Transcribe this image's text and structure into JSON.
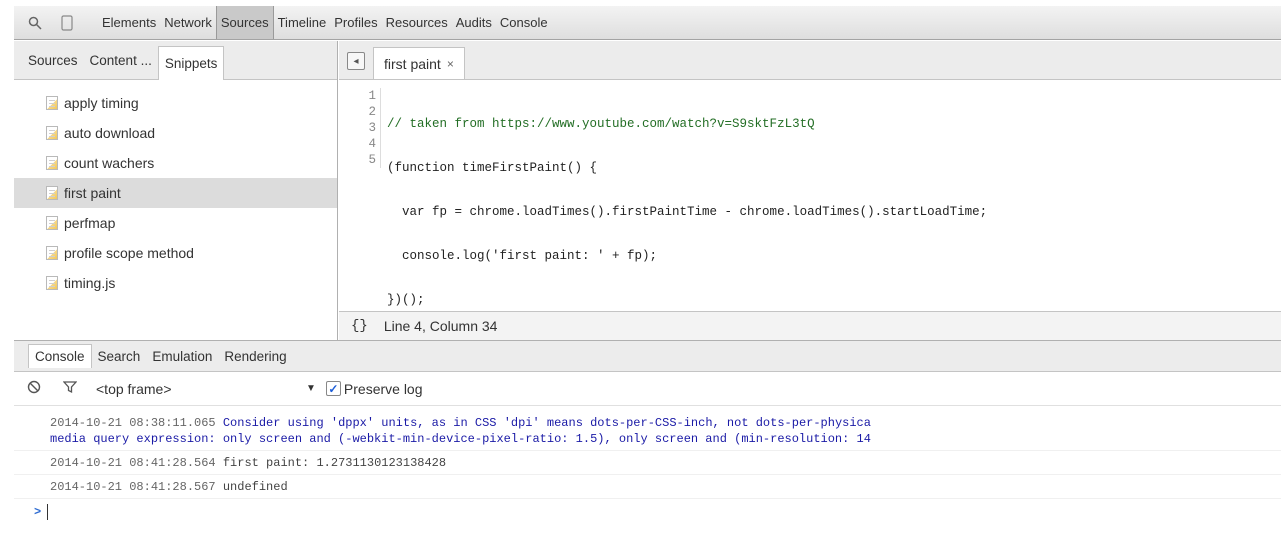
{
  "toolbar": {
    "tabs": [
      "Elements",
      "Network",
      "Sources",
      "Timeline",
      "Profiles",
      "Resources",
      "Audits",
      "Console"
    ],
    "active_tab": "Sources"
  },
  "left_panel": {
    "tabs": [
      "Sources",
      "Content ...",
      "Snippets"
    ],
    "snippets": [
      "apply timing",
      "auto download",
      "count wachers",
      "first paint",
      "perfmap",
      "profile scope method",
      "timing.js"
    ]
  },
  "editor": {
    "tab_label": "first paint",
    "close_glyph": "×",
    "line_numbers": [
      "1",
      "2",
      "3",
      "4",
      "5"
    ],
    "code_lines": [
      "// taken from https://www.youtube.com/watch?v=S9sktFzL3tQ",
      "(function timeFirstPaint() {",
      "  var fp = chrome.loadTimes().firstPaintTime - chrome.loadTimes().startLoadTime;",
      "  console.log('first paint: ' + fp);",
      "})();"
    ],
    "status_braces": "{}",
    "status_position": "Line 4, Column 34"
  },
  "drawer": {
    "tabs": [
      "Console",
      "Search",
      "Emulation",
      "Rendering"
    ]
  },
  "console_toolbar": {
    "frame": "<top frame>",
    "preserve_log_label": "Preserve log",
    "preserve_log_checked": true
  },
  "console": {
    "messages": [
      {
        "ts": "2014-10-21 08:38:11.065",
        "text": "Consider using 'dppx' units, as in CSS 'dpi' means dots-per-CSS-inch, not dots-per-physica",
        "continuation": "media query expression: only screen and (-webkit-min-device-pixel-ratio: 1.5), only screen and (min-resolution: 14"
      },
      {
        "ts": "2014-10-21 08:41:28.564",
        "text": "first paint: 1.2731130123138428"
      },
      {
        "ts": "2014-10-21 08:41:28.567",
        "text": "undefined"
      }
    ],
    "prompt": ">"
  },
  "colors": {
    "comment": "#236e25",
    "keyword": "#aa0d91",
    "string": "#c41a16",
    "warning_text": "#1a1aa6"
  }
}
